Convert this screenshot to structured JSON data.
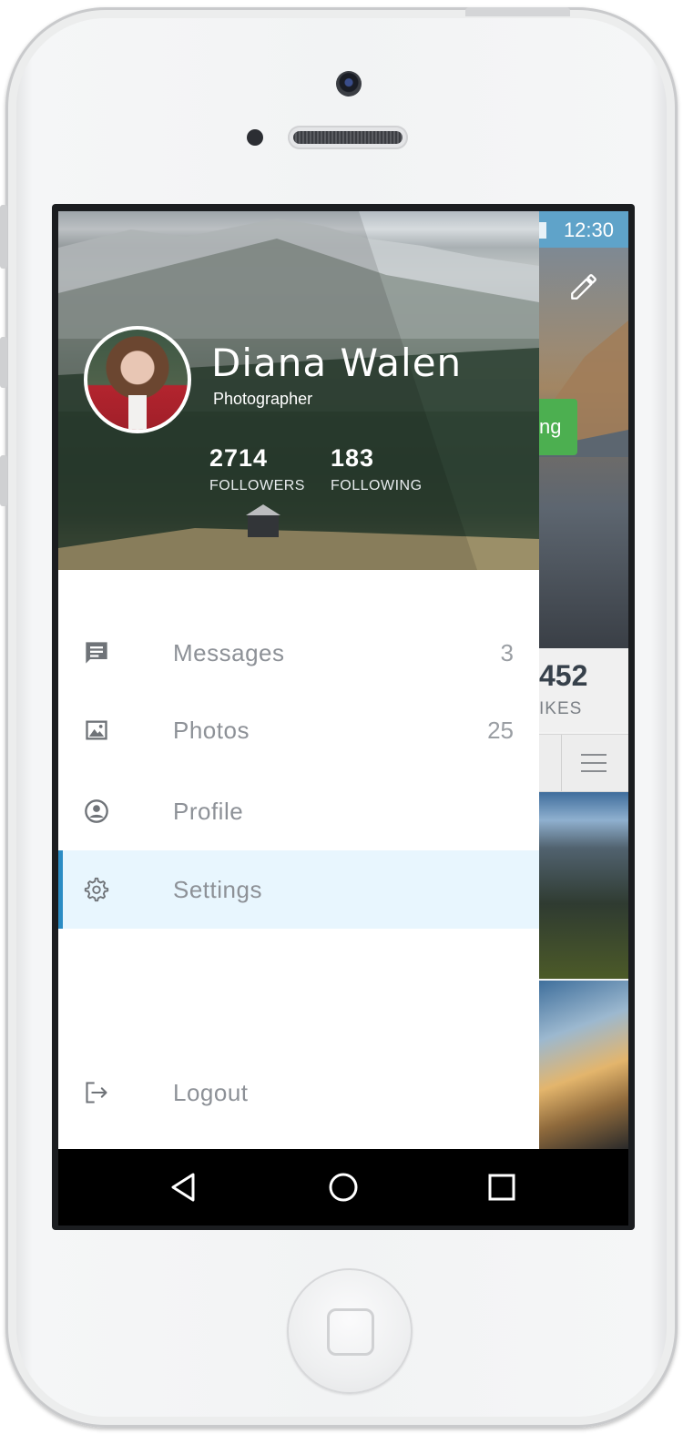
{
  "status_bar": {
    "time": "12:30"
  },
  "background_app": {
    "button_partial": "ng",
    "likes_count_partial": "452",
    "likes_label_partial": "IKES"
  },
  "profile": {
    "name": "Diana Walen",
    "role": "Photographer",
    "followers": {
      "count": "2714",
      "label": "FOLLOWERS"
    },
    "following": {
      "count": "183",
      "label": "FOLLOWING"
    }
  },
  "menu": {
    "items": [
      {
        "label": "Messages",
        "count": "3",
        "icon": "message-icon"
      },
      {
        "label": "Photos",
        "count": "25",
        "icon": "image-icon"
      },
      {
        "label": "Profile",
        "count": "",
        "icon": "account-circle-icon"
      },
      {
        "label": "Settings",
        "count": "",
        "icon": "gear-icon",
        "active": true
      }
    ],
    "logout": {
      "label": "Logout",
      "icon": "logout-icon"
    }
  },
  "colors": {
    "active_bg": "#e8f6fe",
    "active_accent": "#2b8cc4",
    "text_muted": "#8d9197",
    "green_button": "#4caf50",
    "status_bar": "#5fa3c9"
  }
}
